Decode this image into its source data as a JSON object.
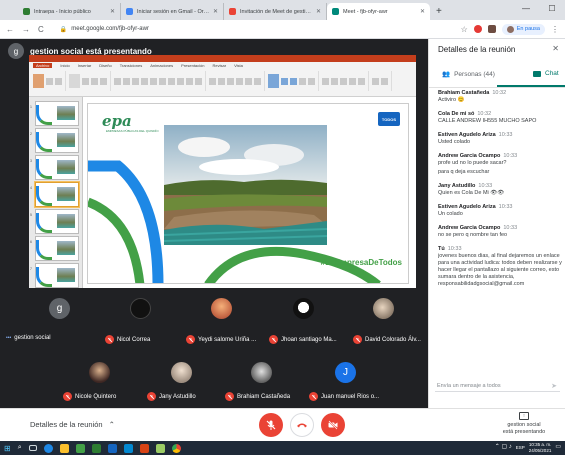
{
  "browser": {
    "tabs": [
      {
        "label": "Intraepa - Inicio público",
        "color": "#2e7d32",
        "active": false
      },
      {
        "label": "Iniciar sesión en Gmail - Ordenar",
        "color": "#4285f4",
        "active": false
      },
      {
        "label": "Invitación de Meet de gestion so",
        "color": "#ea4335",
        "active": false
      },
      {
        "label": "Meet - fjb-ofyr-awr",
        "color": "#00897b",
        "active": true
      }
    ],
    "new_tab": "+",
    "url": "meet.google.com/fjb-ofyr-awr",
    "profile_label": "En pausa"
  },
  "meet": {
    "presenting_avatar": "g",
    "presenting_text": "gestion social está presentando",
    "slide": {
      "logo_text": "epa",
      "logo_sub": "EMPRESAS PÚBLICAS DEL QUINDÍO",
      "badge": "TODOS",
      "hashtag": "#LaEmpresaDeTodos"
    },
    "ribbon_tabs": [
      "Archivo",
      "Inicio",
      "Insertar",
      "Diseño",
      "Transiciones",
      "Animaciones",
      "Presentación",
      "Revisar",
      "Vista"
    ],
    "participants_row1": [
      {
        "name": "gestion social",
        "initial": "g",
        "muted": false,
        "more": "•••"
      },
      {
        "name": "Nicol Correa",
        "muted": true
      },
      {
        "name": "Yeydi salome Uriña ...",
        "muted": true
      },
      {
        "name": "Jhoan santiago Ma...",
        "muted": true
      },
      {
        "name": "David Colorado Álv...",
        "muted": true
      }
    ],
    "participants_row2": [
      {
        "name": "Nicole Quintero",
        "muted": true
      },
      {
        "name": "Jany Astudillo",
        "muted": true
      },
      {
        "name": "Brahiam Castañeda",
        "muted": true
      },
      {
        "name": "Juan manuel Rios o...",
        "initial": "J",
        "muted": true
      }
    ],
    "details_label": "Detalles de la reunión",
    "present_label_line1": "gestion social",
    "present_label_line2": "está presentando"
  },
  "panel": {
    "title": "Detalles de la reunión",
    "people_label": "Personas (44)",
    "chat_label": "Chat",
    "messages": [
      {
        "author": "Brahiam Castañeda",
        "time": "10:32",
        "text": "Activiro 😊"
      },
      {
        "author": "Cola De mi só",
        "time": "10:32",
        "text": "CALLE ANDREW IH555 MUCHO SAPO"
      },
      {
        "author": "Estiven Agudelo Ariza",
        "time": "10:33",
        "text": "Usted colado"
      },
      {
        "author": "Andrew Garcia Ocampo",
        "time": "10:33",
        "text": "profe ud no lo puede sacar?"
      },
      {
        "author": "",
        "time": "",
        "text": "para q deja escuchar"
      },
      {
        "author": "Jany Astudillo",
        "time": "10:33",
        "text": "Quien es Cola De Mi 👁👁"
      },
      {
        "author": "Estiven Agudelo Ariza",
        "time": "10:33",
        "text": "Un colado"
      },
      {
        "author": "Andrew Garcia Ocampo",
        "time": "10:33",
        "text": "no se pero q nombre tan feo"
      },
      {
        "author": "Tú",
        "time": "10:33",
        "text": "jovenes buenos dias, al final dejaremos un enlace para una actividad ludica: todos deben realizarse y hacer llegar el pantallazo al siguiente correo, esto sumara dentro de la asistencia, responsabilidadgsocial@gmail.com"
      }
    ],
    "chat_placeholder": "Envía un mensaje a todos"
  },
  "taskbar": {
    "lang": "ESP",
    "time": "10:35 a. m.",
    "date": "24/05/2021"
  }
}
